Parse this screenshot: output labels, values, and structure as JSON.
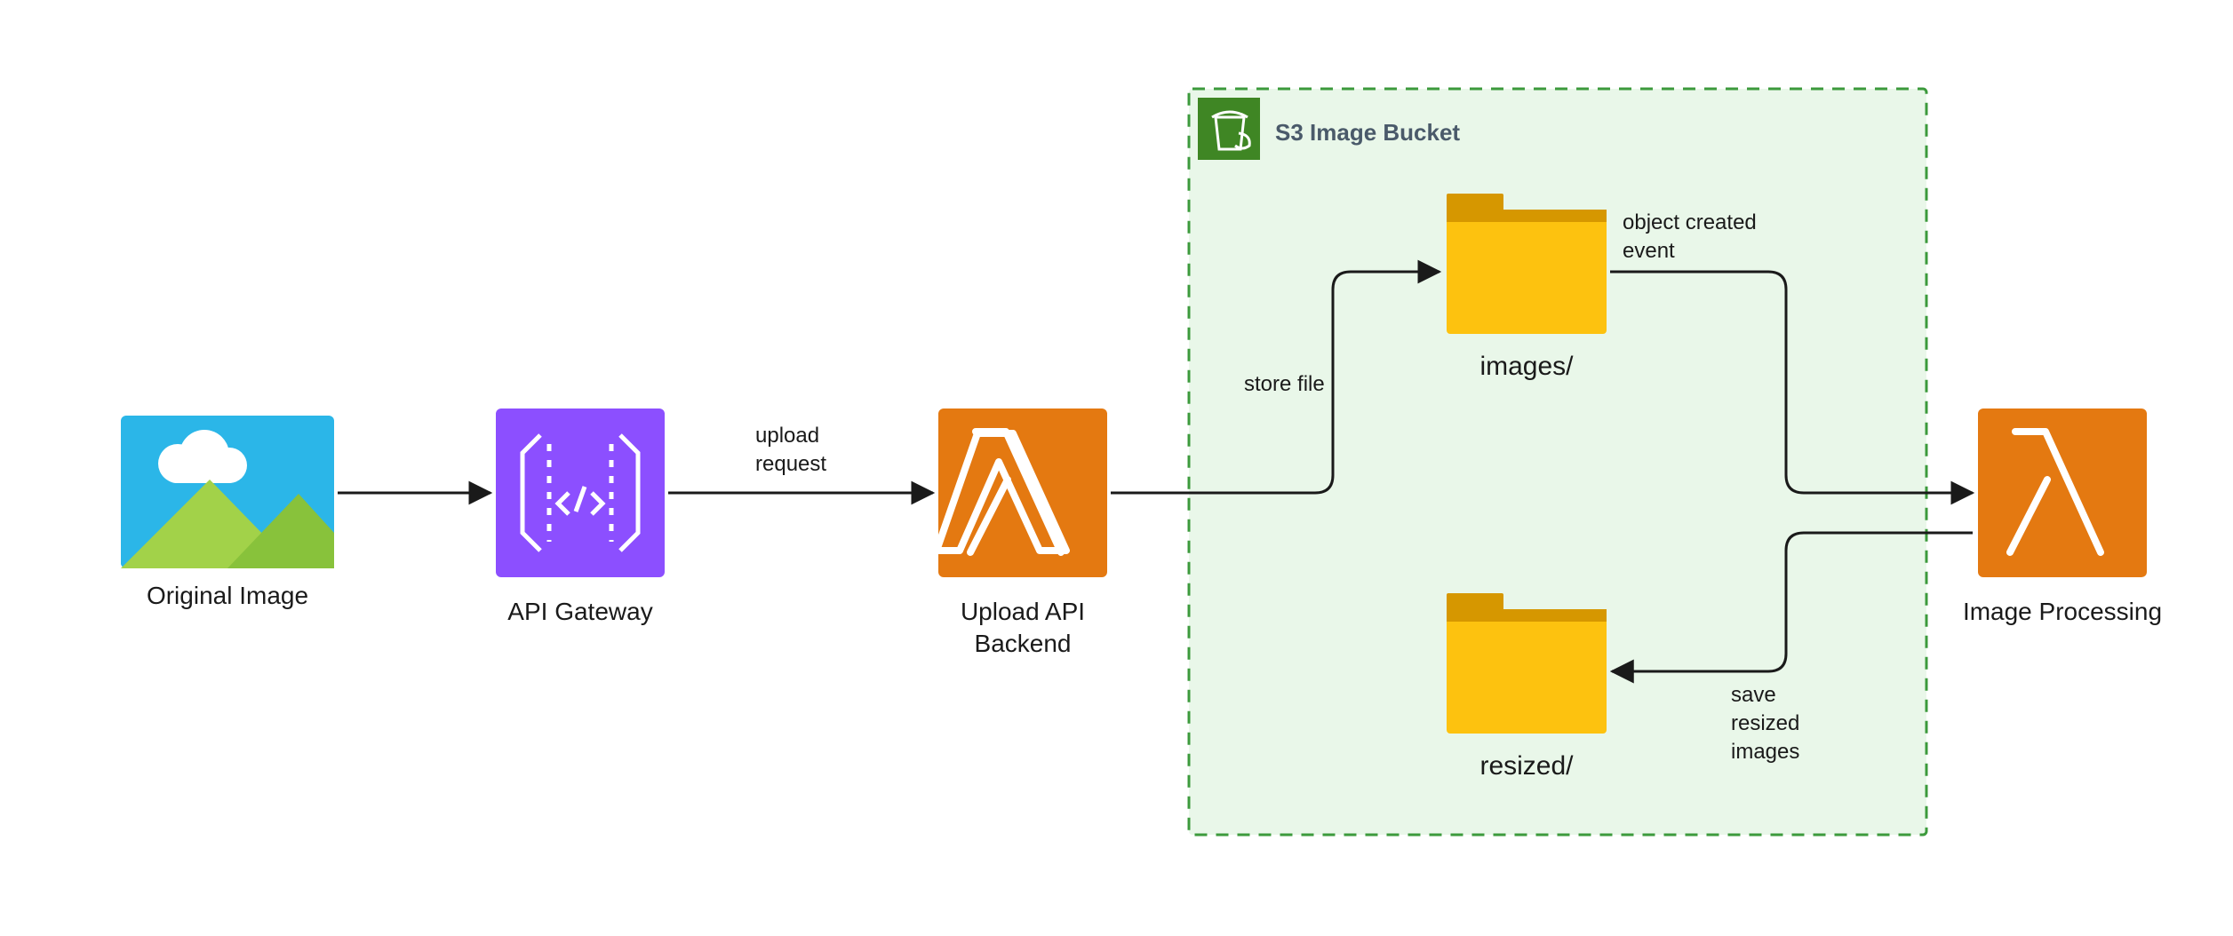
{
  "nodes": {
    "original_image": {
      "label": "Original Image"
    },
    "api_gateway": {
      "label": "API Gateway"
    },
    "upload_backend": {
      "label1": "Upload API",
      "label2": "Backend"
    },
    "image_proc": {
      "label": "Image Processing"
    },
    "folder_images": {
      "label": "images/"
    },
    "folder_resized": {
      "label": "resized/"
    }
  },
  "bucket": {
    "title": "S3 Image Bucket"
  },
  "edges": {
    "upload_request": {
      "l1": "upload",
      "l2": "request"
    },
    "store_file": {
      "l1": "store file"
    },
    "object_created": {
      "l1": "object created",
      "l2": "event"
    },
    "save_resized": {
      "l1": "save",
      "l2": "resized",
      "l3": "images"
    }
  },
  "colors": {
    "api_gateway": "#8c4fff",
    "lambda": "#e47911",
    "s3_green": "#3f8624",
    "bucket_bg": "#e9f7e9",
    "bucket_border": "#3c9a3c",
    "folder": "#fdc20f",
    "folder_tab": "#d69700"
  }
}
